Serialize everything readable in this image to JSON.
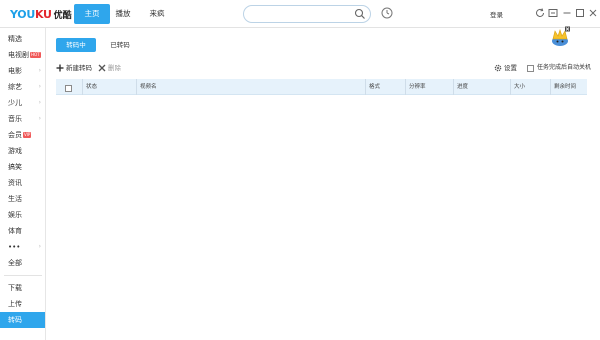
{
  "app": {
    "logo_text_1": "YOU",
    "logo_text_2": "KU",
    "logo_cn": "优酷"
  },
  "nav": {
    "tabs": [
      {
        "label": "主页",
        "active": true
      },
      {
        "label": "播放",
        "active": false
      },
      {
        "label": "来疯",
        "active": false
      }
    ]
  },
  "search": {
    "value": "",
    "placeholder": ""
  },
  "header": {
    "login_label": "登录"
  },
  "sidebar": {
    "items": [
      {
        "label": "精选",
        "arrow": ""
      },
      {
        "label": "电视剧",
        "hot": "HOT",
        "arrow": ""
      },
      {
        "label": "电影",
        "arrow": "›"
      },
      {
        "label": "综艺",
        "arrow": "›"
      },
      {
        "label": "少儿",
        "arrow": "›"
      },
      {
        "label": "音乐",
        "arrow": "›"
      },
      {
        "label": "会员",
        "hot": "VIP",
        "arrow": ""
      },
      {
        "label": "游戏",
        "arrow": ""
      },
      {
        "label": "搞笑",
        "arrow": ""
      },
      {
        "label": "资讯",
        "arrow": ""
      },
      {
        "label": "生活",
        "arrow": ""
      },
      {
        "label": "娱乐",
        "arrow": ""
      },
      {
        "label": "体育",
        "arrow": ""
      },
      {
        "label": "•••",
        "arrow": "›"
      },
      {
        "label": "全部",
        "arrow": ""
      },
      {
        "label": "下载",
        "arrow": ""
      },
      {
        "label": "上传",
        "arrow": ""
      },
      {
        "label": "转码",
        "arrow": "",
        "active": true
      }
    ]
  },
  "subtabs": {
    "active_label": "转码中",
    "inactive_label": "已转码"
  },
  "toolbar": {
    "new_label": "新建转码",
    "delete_label": "删除",
    "settings_label": "设置",
    "shutdown_label": "任务完成后自动关机"
  },
  "table": {
    "columns": [
      "状态",
      "视频名",
      "格式",
      "分辨率",
      "进度",
      "大小",
      "剩余时间"
    ]
  },
  "colors": {
    "accent": "#2fa6ec",
    "header_bg": "#e6f2fb",
    "logo_blue": "#1ea0e8",
    "logo_red": "#e3262d"
  }
}
